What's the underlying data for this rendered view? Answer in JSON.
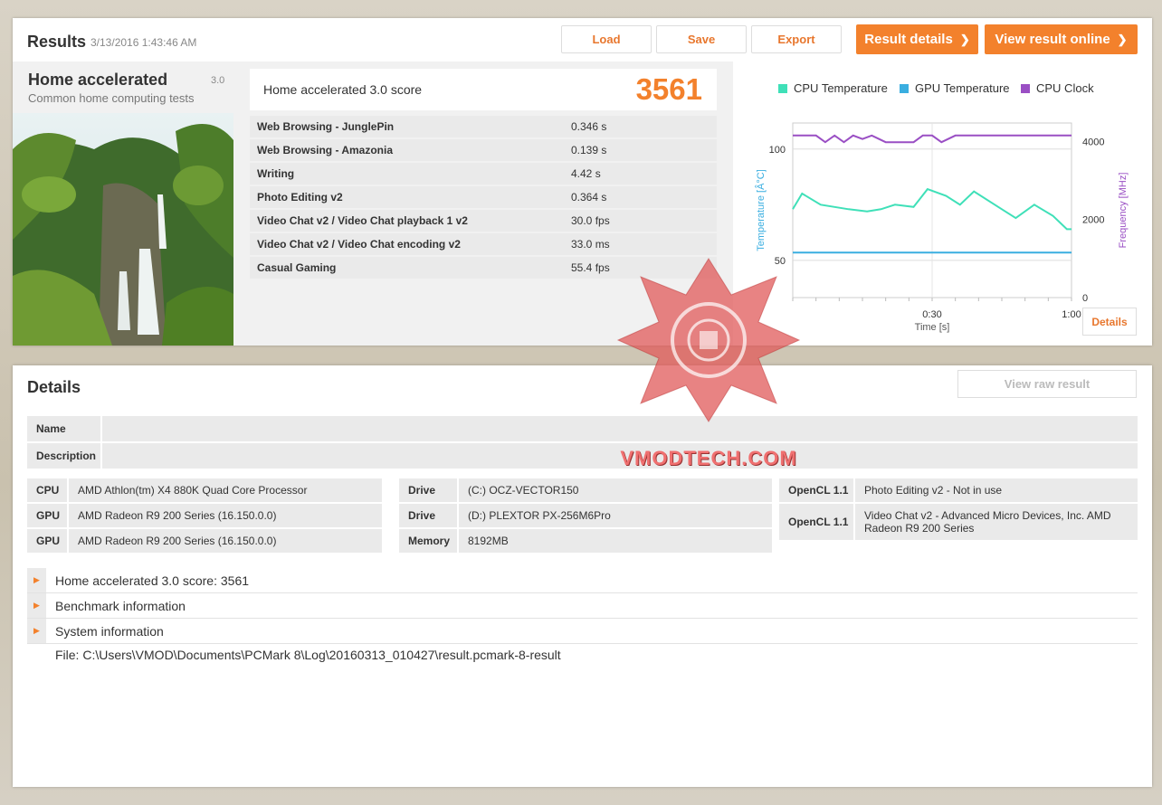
{
  "header": {
    "title": "Results",
    "date": "3/13/2016 1:43:46 AM",
    "buttons": {
      "load": "Load",
      "save": "Save",
      "export": "Export",
      "result_details": "Result details",
      "view_online": "View result online"
    }
  },
  "test": {
    "name": "Home accelerated",
    "version": "3.0",
    "description": "Common home computing tests"
  },
  "score": {
    "label": "Home accelerated 3.0 score",
    "value": "3561"
  },
  "subscores": [
    {
      "name": "Web Browsing - JunglePin",
      "value": "0.346 s"
    },
    {
      "name": "Web Browsing - Amazonia",
      "value": "0.139 s"
    },
    {
      "name": "Writing",
      "value": "4.42 s"
    },
    {
      "name": "Photo Editing v2",
      "value": "0.364 s"
    },
    {
      "name": "Video Chat v2 / Video Chat playback 1 v2",
      "value": "30.0 fps"
    },
    {
      "name": "Video Chat v2 / Video Chat encoding v2",
      "value": "33.0 ms"
    },
    {
      "name": "Casual Gaming",
      "value": "55.4 fps"
    }
  ],
  "chart_data": {
    "type": "line",
    "legend": [
      "CPU Temperature",
      "GPU Temperature",
      "CPU Clock"
    ],
    "colors": {
      "cpu_temp": "#3fe0b8",
      "gpu_temp": "#3aaee0",
      "cpu_clock": "#9a4fc4"
    },
    "xlabel": "Time [s]",
    "ylabel_left": "Temperature [Â°C]",
    "ylabel_right": "Frequency [MHz]",
    "x_ticks": [
      "0:30",
      "1:00"
    ],
    "y_left_ticks": [
      "100",
      "50"
    ],
    "y_right_ticks": [
      "4000",
      "2000",
      "0"
    ],
    "xlim": [
      0,
      60
    ],
    "ylim_left": [
      33.3,
      111.7
    ],
    "ylim_right": [
      0,
      4470
    ],
    "series": [
      {
        "name": "CPU Temperature",
        "x": [
          0,
          2,
          6,
          12,
          16,
          19,
          22,
          26,
          29,
          33,
          36,
          39,
          45,
          48,
          52,
          56,
          59,
          60
        ],
        "y": [
          73,
          80,
          75,
          73,
          72,
          73,
          75,
          74,
          82,
          79,
          75,
          81,
          73,
          69,
          75,
          70,
          64,
          64
        ]
      },
      {
        "name": "GPU Temperature",
        "x": [
          0,
          60
        ],
        "y": [
          53.5,
          53.5
        ]
      },
      {
        "name": "CPU Clock",
        "x": [
          0,
          5,
          7,
          9,
          11,
          13,
          15,
          17,
          20,
          22,
          26,
          28,
          30,
          32,
          35,
          40,
          50,
          60
        ],
        "y": [
          4150,
          4150,
          3980,
          4150,
          3980,
          4150,
          4060,
          4150,
          3980,
          3980,
          3980,
          4150,
          4150,
          3980,
          4150,
          4150,
          4150,
          4150
        ]
      }
    ],
    "details_button": "Details"
  },
  "details": {
    "title": "Details",
    "view_raw": "View raw result",
    "name_label": "Name",
    "description_label": "Description",
    "hardware_left": [
      {
        "k": "CPU",
        "v": "AMD Athlon(tm) X4 880K Quad Core Processor"
      },
      {
        "k": "GPU",
        "v": "AMD Radeon R9 200 Series (16.150.0.0)"
      },
      {
        "k": "GPU",
        "v": "AMD Radeon R9 200 Series (16.150.0.0)"
      }
    ],
    "hardware_mid": [
      {
        "k": "Drive",
        "v": "(C:) OCZ-VECTOR150"
      },
      {
        "k": "Drive",
        "v": "(D:) PLEXTOR PX-256M6Pro"
      },
      {
        "k": "Memory",
        "v": "8192MB"
      }
    ],
    "hardware_right": [
      {
        "k": "OpenCL 1.1",
        "v": "Photo Editing v2 - Not in use"
      },
      {
        "k": "OpenCL 1.1",
        "v": "Video Chat v2 - Advanced Micro Devices, Inc. AMD Radeon R9 200 Series"
      }
    ],
    "expanders": [
      "Home accelerated 3.0 score: 3561",
      "Benchmark information",
      "System information"
    ],
    "file_path": "File: C:\\Users\\VMOD\\Documents\\PCMark 8\\Log\\20160313_010427\\result.pcmark-8-result"
  },
  "watermark": "VMODTECH.COM"
}
